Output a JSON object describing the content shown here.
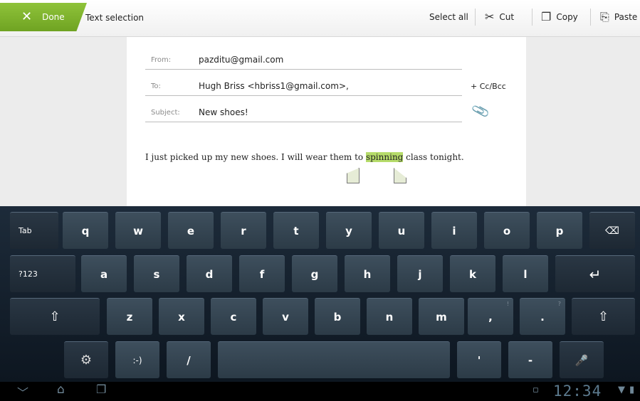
{
  "action_bar": {
    "done_label": "Done",
    "mode_title": "Text selection",
    "select_all": "Select all",
    "cut": "Cut",
    "copy": "Copy",
    "paste": "Paste",
    "accent_color": "#7fb52e"
  },
  "compose": {
    "from_label": "From:",
    "from_value": "pazditu@gmail.com",
    "to_label": "To:",
    "to_value": "Hugh Briss <hbriss1@gmail.com>,",
    "cc_bcc": "+ Cc/Bcc",
    "subject_label": "Subject:",
    "subject_value": "New shoes!",
    "body_before": "I just picked up my new shoes. I will wear them to ",
    "body_selected": "spinning",
    "body_after": " class tonight."
  },
  "keyboard": {
    "row1": [
      "Tab",
      "q",
      "w",
      "e",
      "r",
      "t",
      "y",
      "u",
      "i",
      "o",
      "p"
    ],
    "row2": [
      "?123",
      "a",
      "s",
      "d",
      "f",
      "g",
      "h",
      "j",
      "k",
      "l"
    ],
    "row3": [
      "z",
      "x",
      "c",
      "v",
      "b",
      "n",
      "m",
      ",",
      "."
    ],
    "row3_sups": [
      "!",
      "?"
    ],
    "row4": [
      ":-)",
      "/",
      "'",
      "-"
    ]
  },
  "nav": {
    "clock": "12:34"
  }
}
